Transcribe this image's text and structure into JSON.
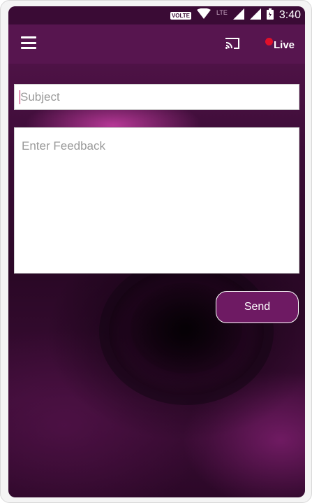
{
  "status_bar": {
    "volte": "VOLTE",
    "lte": "LTE",
    "time": "3:40",
    "icons": [
      "wifi-icon",
      "signal-icon",
      "signal-icon",
      "battery-icon"
    ]
  },
  "app_bar": {
    "menu_icon": "menu-icon",
    "cast_icon": "cast-icon",
    "live_label": "Live",
    "live_dot_color": "#e0102a",
    "background_color": "#57154f"
  },
  "form": {
    "subject": {
      "value": "",
      "placeholder": "Subject"
    },
    "feedback": {
      "value": "",
      "placeholder": "Enter Feedback"
    },
    "send_label": "Send"
  },
  "theme": {
    "accent": "#6e1a63",
    "status_bar_color": "#3a0b35"
  }
}
